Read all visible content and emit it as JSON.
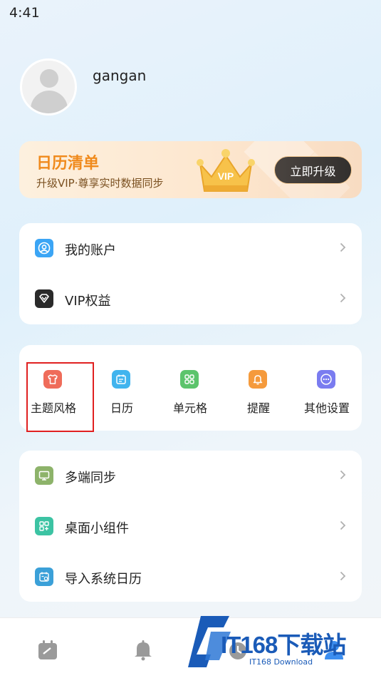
{
  "status_bar": {
    "time": "4:41"
  },
  "profile": {
    "username": "gangan"
  },
  "vip_banner": {
    "title": "日历清单",
    "subtitle": "升级VIP·尊享实时数据同步",
    "crown_badge": "VIP",
    "button_label": "立即升级"
  },
  "account_card": {
    "items": [
      {
        "label": "我的账户",
        "icon": "account-icon",
        "color": "#3ba5f5"
      },
      {
        "label": "VIP权益",
        "icon": "diamond-icon",
        "color": "#2a2a2a"
      }
    ]
  },
  "feature_grid": {
    "items": [
      {
        "label": "主题风格",
        "icon": "shirt-icon",
        "color": "#ef6c5a"
      },
      {
        "label": "日历",
        "icon": "calendar-icon",
        "color": "#41b4ee"
      },
      {
        "label": "单元格",
        "icon": "grid-icon",
        "color": "#5cc46c"
      },
      {
        "label": "提醒",
        "icon": "bell-icon",
        "color": "#f59a3c"
      },
      {
        "label": "其他设置",
        "icon": "more-icon",
        "color": "#7a7cf0"
      }
    ]
  },
  "sync_card": {
    "items": [
      {
        "label": "多端同步",
        "icon": "monitor-icon",
        "color": "#8db36a"
      },
      {
        "label": "桌面小组件",
        "icon": "widget-icon",
        "color": "#3cc3a3"
      },
      {
        "label": "导入系统日历",
        "icon": "import-calendar-icon",
        "color": "#3ba0d8"
      }
    ]
  },
  "tabbar": {
    "tabs": [
      {
        "icon": "calendar-tab-icon"
      },
      {
        "icon": "bell-tab-icon"
      },
      {
        "icon": "timer-tab-icon"
      },
      {
        "icon": "profile-tab-icon"
      }
    ]
  },
  "watermark": {
    "text": "IT168下载站",
    "sub": "IT168 Download"
  }
}
